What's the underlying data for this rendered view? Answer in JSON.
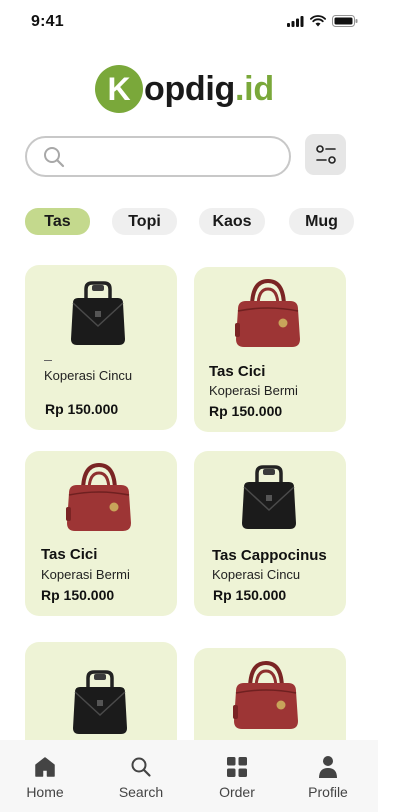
{
  "status_bar": {
    "time": "9:41"
  },
  "logo": {
    "letter": "K",
    "text": "opdig",
    "suffix": ".id"
  },
  "search": {
    "placeholder": "",
    "value": ""
  },
  "tabs": [
    {
      "label": "Tas",
      "active": true
    },
    {
      "label": "Topi",
      "active": false
    },
    {
      "label": "Kaos",
      "active": false
    },
    {
      "label": "Mug",
      "active": false
    }
  ],
  "products": [
    {
      "name": "",
      "shop": "Koperasi Cincu",
      "price": "Rp 150.000",
      "bag": "black"
    },
    {
      "name": "Tas Cici",
      "shop": "Koperasi Bermi",
      "price": "Rp 150.000",
      "bag": "red"
    },
    {
      "name": "Tas Cici",
      "shop": "Koperasi Bermi",
      "price": "Rp 150.000",
      "bag": "red"
    },
    {
      "name": "Tas Cappocinus",
      "shop": "Koperasi Cincu",
      "price": "Rp 150.000",
      "bag": "black"
    },
    {
      "name": "",
      "shop": "",
      "price": "",
      "bag": "black"
    },
    {
      "name": "",
      "shop": "",
      "price": "",
      "bag": "red"
    }
  ],
  "bottom_nav": [
    {
      "label": "Home",
      "icon": "home-icon"
    },
    {
      "label": "Search",
      "icon": "search-icon"
    },
    {
      "label": "Order",
      "icon": "grid-icon"
    },
    {
      "label": "Profile",
      "icon": "user-icon"
    }
  ],
  "colors": {
    "brand_green": "#7aa83a",
    "card_bg": "#eef3d6",
    "active_tab": "#c4d98d"
  }
}
